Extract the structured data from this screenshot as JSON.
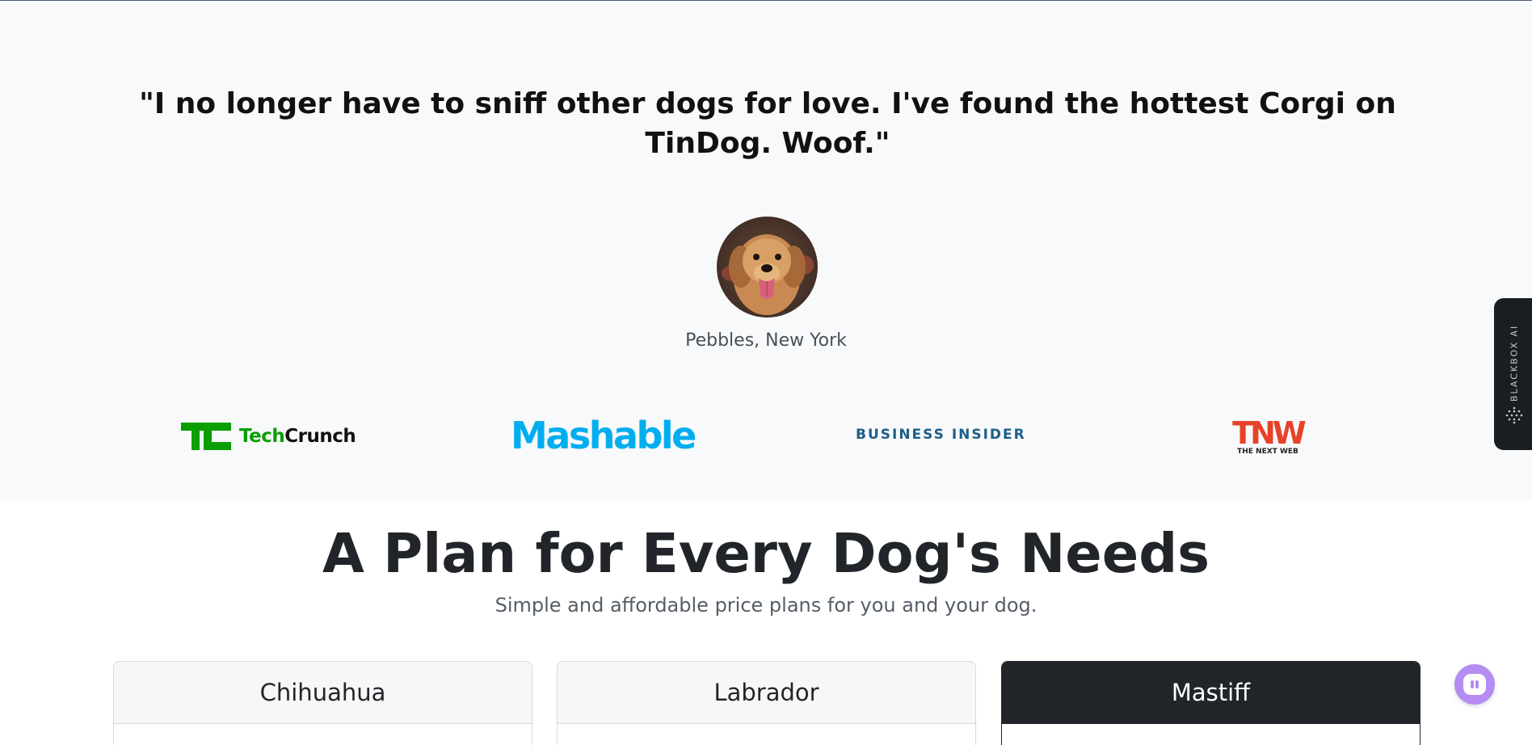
{
  "testimonial": {
    "quote": "\"I no longer have to sniff other dogs for love. I've found the hottest Corgi on TinDog. Woof.\"",
    "author": "Pebbles, New York",
    "avatar_alt": "dog-photo"
  },
  "press_logos": {
    "techcrunch": {
      "tech": "Tech",
      "crunch": "Crunch"
    },
    "mashable": "Mashable",
    "business_insider": "BUSINESS INSIDER",
    "tnw": {
      "big": "TNW",
      "small": "THE NEXT WEB"
    }
  },
  "side_widget": {
    "label": "BLACKBOX AI"
  },
  "pricing": {
    "title": "A Plan for Every Dog's Needs",
    "subtitle": "Simple and affordable price plans for you and your dog.",
    "plans": [
      {
        "name": "Chihuahua"
      },
      {
        "name": "Labrador"
      },
      {
        "name": "Mastiff"
      }
    ]
  },
  "colors": {
    "section_bg": "#f8f9fa",
    "techcrunch_green": "#0a9e01",
    "mashable_blue": "#00aeef",
    "business_insider_blue": "#1c5f88",
    "tnw_red": "#e8412a",
    "dark_card": "#212529",
    "chat_purple": "#b48cf2"
  },
  "icons": [
    "chat-icon",
    "blackbox-dots-icon"
  ]
}
